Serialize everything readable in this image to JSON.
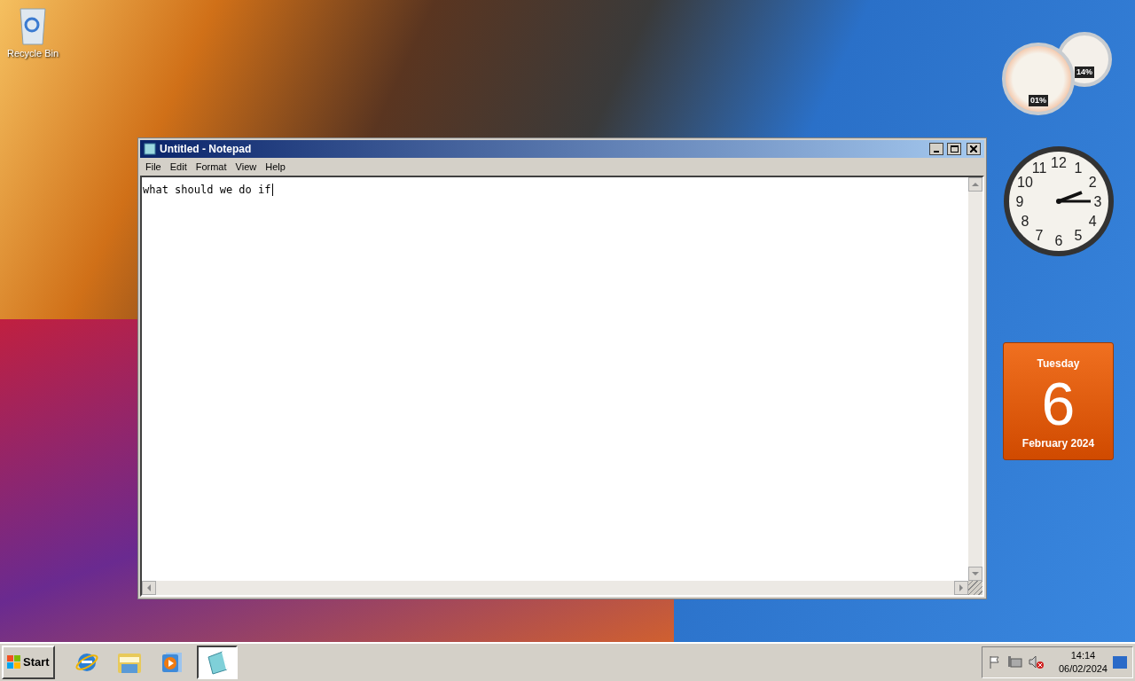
{
  "desktop_icons": [
    {
      "label": "Recycle Bin"
    }
  ],
  "gadgets": {
    "cpu_meter": {
      "readings": [
        "01%",
        "14%"
      ]
    },
    "clock": {
      "numerals": [
        "12",
        "11",
        "1",
        "10",
        "2",
        "9",
        "3",
        "8",
        "4",
        "7",
        "5",
        "6"
      ]
    },
    "calendar": {
      "weekday": "Tuesday",
      "day": "6",
      "month_year": "February 2024"
    }
  },
  "window": {
    "title": "Untitled - Notepad",
    "menu": [
      "File",
      "Edit",
      "Format",
      "View",
      "Help"
    ],
    "text": "what should we do if"
  },
  "taskbar": {
    "start_label": "Start",
    "apps": [
      {
        "kind": "browser",
        "selected": false
      },
      {
        "kind": "folder",
        "selected": false
      },
      {
        "kind": "media",
        "selected": false
      },
      {
        "kind": "notepad",
        "selected": true
      }
    ],
    "time": "14:14",
    "date": "06/02/2024"
  }
}
